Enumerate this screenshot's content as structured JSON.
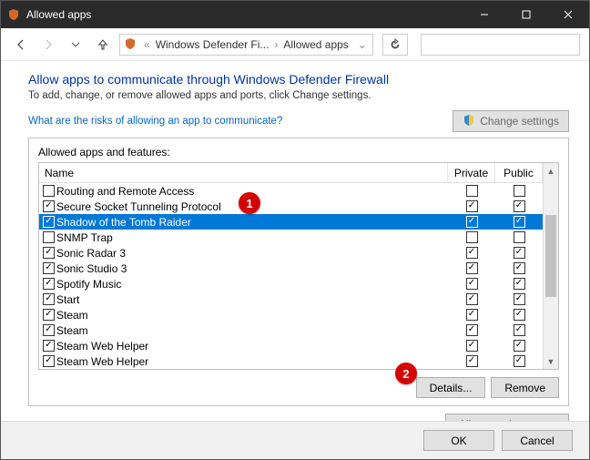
{
  "window": {
    "title": "Allowed apps"
  },
  "breadcrumb": {
    "root": "Windows Defender Fi...",
    "current": "Allowed apps"
  },
  "page": {
    "heading": "Allow apps to communicate through Windows Defender Firewall",
    "subtext": "To add, change, or remove allowed apps and ports, click Change settings.",
    "risk_link": "What are the risks of allowing an app to communicate?",
    "change_settings": "Change settings",
    "group_label": "Allowed apps and features:",
    "columns": {
      "name": "Name",
      "private": "Private",
      "public": "Public"
    },
    "rows": [
      {
        "name": "Routing and Remote Access",
        "enabled": false,
        "private": false,
        "public": false,
        "selected": false
      },
      {
        "name": "Secure Socket Tunneling Protocol",
        "enabled": true,
        "private": true,
        "public": true,
        "selected": false
      },
      {
        "name": "Shadow of the Tomb Raider",
        "enabled": true,
        "private": true,
        "public": true,
        "selected": true
      },
      {
        "name": "SNMP Trap",
        "enabled": false,
        "private": false,
        "public": false,
        "selected": false
      },
      {
        "name": "Sonic Radar 3",
        "enabled": true,
        "private": true,
        "public": true,
        "selected": false
      },
      {
        "name": "Sonic Studio 3",
        "enabled": true,
        "private": true,
        "public": true,
        "selected": false
      },
      {
        "name": "Spotify Music",
        "enabled": true,
        "private": true,
        "public": true,
        "selected": false
      },
      {
        "name": "Start",
        "enabled": true,
        "private": true,
        "public": true,
        "selected": false
      },
      {
        "name": "Steam",
        "enabled": true,
        "private": true,
        "public": true,
        "selected": false
      },
      {
        "name": "Steam",
        "enabled": true,
        "private": true,
        "public": true,
        "selected": false
      },
      {
        "name": "Steam Web Helper",
        "enabled": true,
        "private": true,
        "public": true,
        "selected": false
      },
      {
        "name": "Steam Web Helper",
        "enabled": true,
        "private": true,
        "public": true,
        "selected": false
      }
    ],
    "details_btn": "Details...",
    "remove_btn": "Remove",
    "allow_another_btn": "Allow another app..."
  },
  "footer": {
    "ok": "OK",
    "cancel": "Cancel"
  },
  "annotations": {
    "a1": "1",
    "a2": "2"
  }
}
